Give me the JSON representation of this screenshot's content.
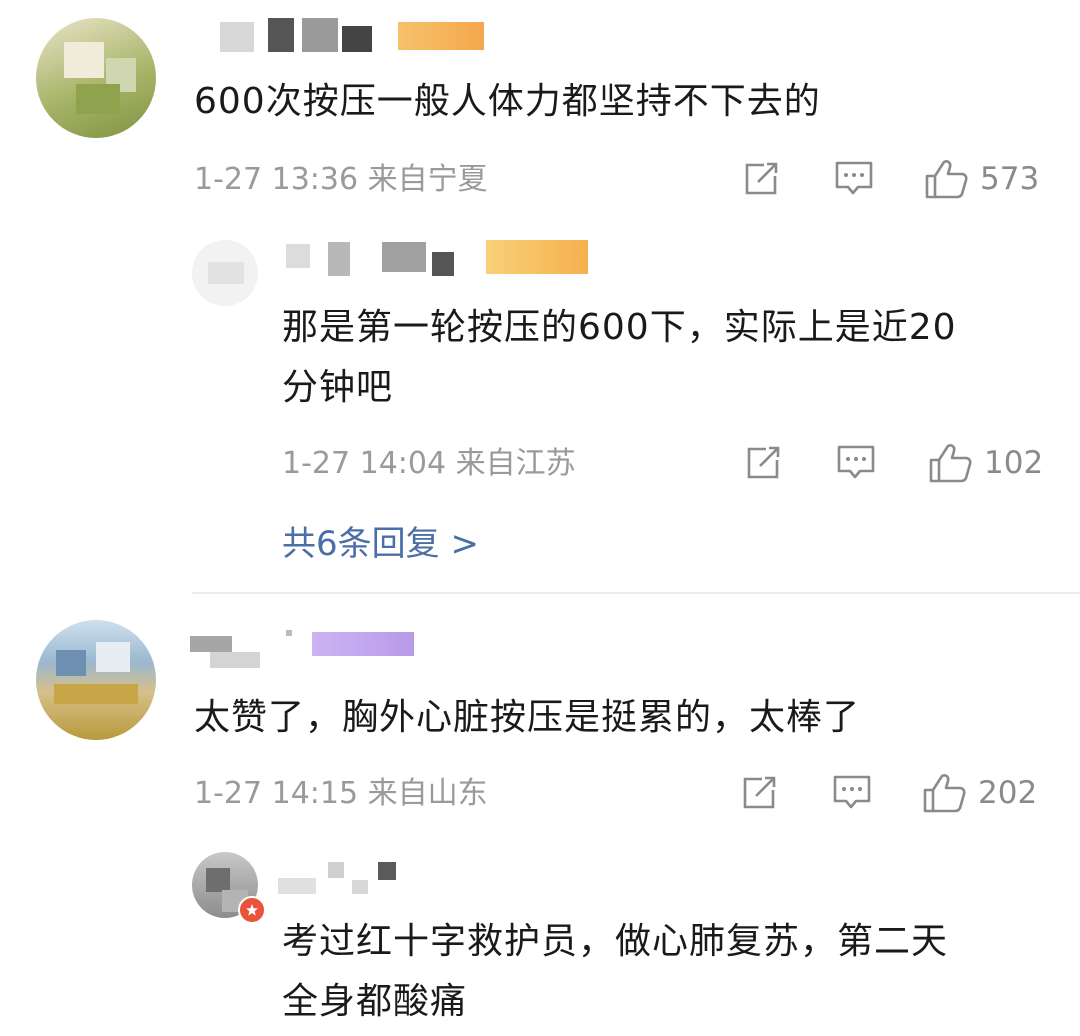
{
  "comments": [
    {
      "text": "600次按压一般人体力都坚持不下去的",
      "time": "1-27 13:36",
      "location": "来自宁夏",
      "likes": "573",
      "replies": [
        {
          "text_lines": [
            "那是第一轮按压的600下，实际上是近20",
            "分钟吧"
          ],
          "time": "1-27 14:04",
          "location": "来自江苏",
          "likes": "102"
        }
      ],
      "more_replies": "共6条回复 >"
    },
    {
      "text": "太赞了，胸外心脏按压是挺累的，太棒了",
      "time": "1-27 14:15",
      "location": "来自山东",
      "likes": "202",
      "replies": [
        {
          "text_lines": [
            "考过红十字救护员，做心肺复苏，第二天",
            "全身都酸痛"
          ]
        }
      ]
    }
  ],
  "icons": {
    "share": "share-icon",
    "comment": "comment-icon",
    "like": "like-icon",
    "badge": "badge-icon"
  },
  "colors": {
    "link": "#4a6ea8",
    "meta": "#9a9a9a",
    "text": "#1a1a1a",
    "badge": "#e8533a"
  }
}
